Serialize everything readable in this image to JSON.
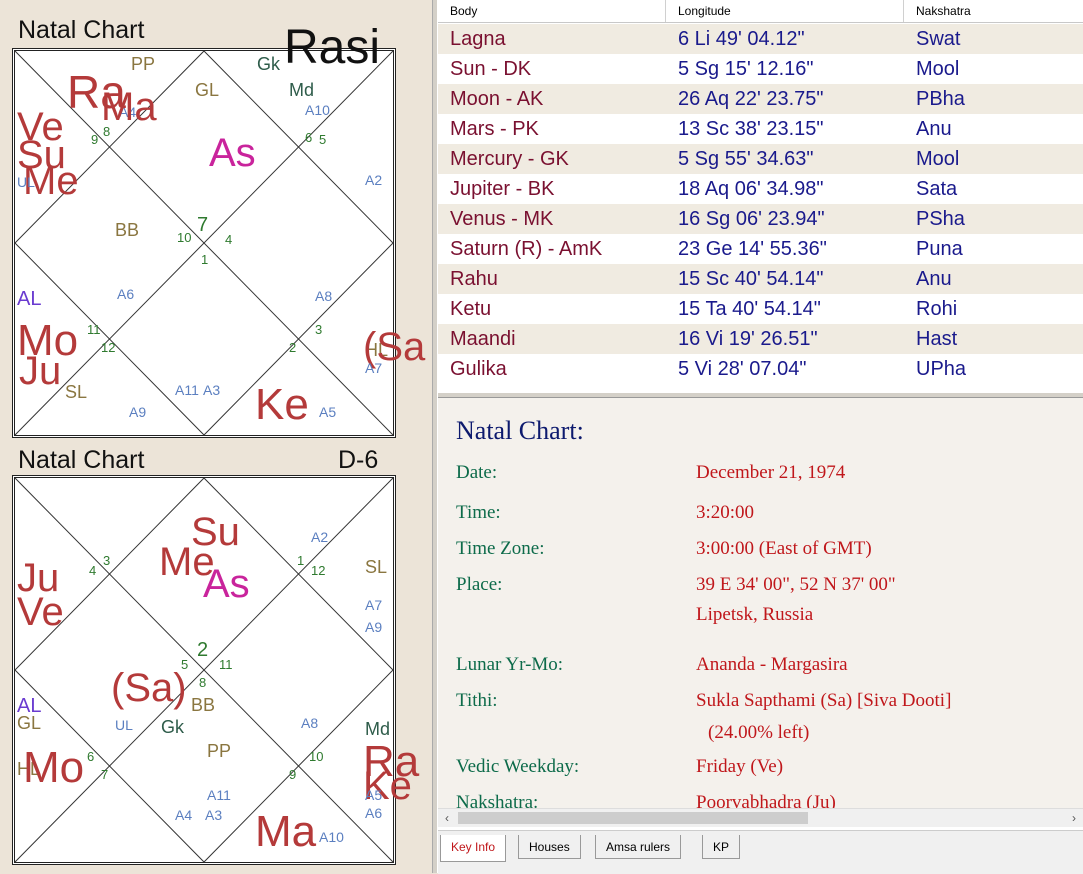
{
  "rasi": {
    "title": "Natal Chart",
    "division": "Rasi",
    "labels": [
      {
        "t": "PP",
        "c": "#8a7640",
        "fs": 18
      },
      {
        "t": "Gk",
        "c": "#2e5c4a",
        "fs": 18
      },
      {
        "t": "GL",
        "c": "#8a7640",
        "fs": 18
      },
      {
        "t": "Md",
        "c": "#2e5c4a",
        "fs": 18
      },
      {
        "t": "A10",
        "c": "#5b7fc0",
        "fs": 14
      },
      {
        "t": "A4",
        "c": "#5b7fc0",
        "fs": 14
      },
      {
        "t": "Ra",
        "c": "#b43a3a",
        "fs": 46
      },
      {
        "t": "Ma",
        "c": "#b43a3a",
        "fs": 40
      },
      {
        "t": "9",
        "c": "#2f7a2f",
        "fs": 13
      },
      {
        "t": "8",
        "c": "#2f7a2f",
        "fs": 13
      },
      {
        "t": "6",
        "c": "#2f7a2f",
        "fs": 13
      },
      {
        "t": "5",
        "c": "#2f7a2f",
        "fs": 13
      },
      {
        "t": "Ve",
        "c": "#b43a3a",
        "fs": 40
      },
      {
        "t": "Su",
        "c": "#b43a3a",
        "fs": 40
      },
      {
        "t": "Me",
        "c": "#b43a3a",
        "fs": 40
      },
      {
        "t": "UL",
        "c": "#5b7fc0",
        "fs": 14
      },
      {
        "t": "As",
        "c": "#c9249c",
        "fs": 40
      },
      {
        "t": "A2",
        "c": "#5b7fc0",
        "fs": 14
      },
      {
        "t": "BB",
        "c": "#8a7640",
        "fs": 18
      },
      {
        "t": "7",
        "c": "#2f7a2f",
        "fs": 20
      },
      {
        "t": "10",
        "c": "#2f7a2f",
        "fs": 13
      },
      {
        "t": "4",
        "c": "#2f7a2f",
        "fs": 13
      },
      {
        "t": "1",
        "c": "#2f7a2f",
        "fs": 13
      },
      {
        "t": "A6",
        "c": "#5b7fc0",
        "fs": 14
      },
      {
        "t": "A8",
        "c": "#5b7fc0",
        "fs": 14
      },
      {
        "t": "AL",
        "c": "#6a3bd0",
        "fs": 20
      },
      {
        "t": "Mo",
        "c": "#b43a3a",
        "fs": 44
      },
      {
        "t": "Ju",
        "c": "#b43a3a",
        "fs": 40
      },
      {
        "t": "11",
        "c": "#2f7a2f",
        "fs": 13
      },
      {
        "t": "12",
        "c": "#2f7a2f",
        "fs": 13
      },
      {
        "t": "3",
        "c": "#2f7a2f",
        "fs": 13
      },
      {
        "t": "2",
        "c": "#2f7a2f",
        "fs": 13
      },
      {
        "t": "HL",
        "c": "#8a7640",
        "fs": 18
      },
      {
        "t": "(Sa",
        "c": "#b43a3a",
        "fs": 40
      },
      {
        "t": "A7",
        "c": "#5b7fc0",
        "fs": 14
      },
      {
        "t": "SL",
        "c": "#8a7640",
        "fs": 18
      },
      {
        "t": "A11",
        "c": "#5b7fc0",
        "fs": 14
      },
      {
        "t": "A3",
        "c": "#5b7fc0",
        "fs": 14
      },
      {
        "t": "A9",
        "c": "#5b7fc0",
        "fs": 14
      },
      {
        "t": "Ke",
        "c": "#b43a3a",
        "fs": 44
      },
      {
        "t": "A5",
        "c": "#5b7fc0",
        "fs": 14
      }
    ]
  },
  "d6": {
    "title": "Natal Chart",
    "division": "D-6",
    "labels": [
      {
        "t": "4",
        "c": "#2f7a2f",
        "fs": 13
      },
      {
        "t": "3",
        "c": "#2f7a2f",
        "fs": 13
      },
      {
        "t": "Su",
        "c": "#b43a3a",
        "fs": 40
      },
      {
        "t": "Me",
        "c": "#b43a3a",
        "fs": 40
      },
      {
        "t": "As",
        "c": "#c9249c",
        "fs": 40
      },
      {
        "t": "A2",
        "c": "#5b7fc0",
        "fs": 14
      },
      {
        "t": "1",
        "c": "#2f7a2f",
        "fs": 13
      },
      {
        "t": "12",
        "c": "#2f7a2f",
        "fs": 13
      },
      {
        "t": "SL",
        "c": "#8a7640",
        "fs": 18
      },
      {
        "t": "Ju",
        "c": "#b43a3a",
        "fs": 40
      },
      {
        "t": "Ve",
        "c": "#b43a3a",
        "fs": 40
      },
      {
        "t": "A7",
        "c": "#5b7fc0",
        "fs": 14
      },
      {
        "t": "A9",
        "c": "#5b7fc0",
        "fs": 14
      },
      {
        "t": "2",
        "c": "#2f7a2f",
        "fs": 20
      },
      {
        "t": "5",
        "c": "#2f7a2f",
        "fs": 13
      },
      {
        "t": "11",
        "c": "#2f7a2f",
        "fs": 13
      },
      {
        "t": "8",
        "c": "#2f7a2f",
        "fs": 13
      },
      {
        "t": "(Sa)",
        "c": "#b43a3a",
        "fs": 40
      },
      {
        "t": "BB",
        "c": "#8a7640",
        "fs": 18
      },
      {
        "t": "AL",
        "c": "#6a3bd0",
        "fs": 20
      },
      {
        "t": "GL",
        "c": "#8a7640",
        "fs": 18
      },
      {
        "t": "UL",
        "c": "#5b7fc0",
        "fs": 14
      },
      {
        "t": "Gk",
        "c": "#2e5c4a",
        "fs": 18
      },
      {
        "t": "A8",
        "c": "#5b7fc0",
        "fs": 14
      },
      {
        "t": "Md",
        "c": "#2e5c4a",
        "fs": 18
      },
      {
        "t": "PP",
        "c": "#8a7640",
        "fs": 18
      },
      {
        "t": "HL",
        "c": "#8a7640",
        "fs": 18
      },
      {
        "t": "Mo",
        "c": "#b43a3a",
        "fs": 44
      },
      {
        "t": "6",
        "c": "#2f7a2f",
        "fs": 13
      },
      {
        "t": "7",
        "c": "#2f7a2f",
        "fs": 13
      },
      {
        "t": "9",
        "c": "#2f7a2f",
        "fs": 13
      },
      {
        "t": "10",
        "c": "#2f7a2f",
        "fs": 13
      },
      {
        "t": "Ra",
        "c": "#b43a3a",
        "fs": 44
      },
      {
        "t": "Ke",
        "c": "#b43a3a",
        "fs": 40
      },
      {
        "t": "A5",
        "c": "#5b7fc0",
        "fs": 14
      },
      {
        "t": "A6",
        "c": "#5b7fc0",
        "fs": 14
      },
      {
        "t": "A11",
        "c": "#5b7fc0",
        "fs": 14
      },
      {
        "t": "A4",
        "c": "#5b7fc0",
        "fs": 14
      },
      {
        "t": "A3",
        "c": "#5b7fc0",
        "fs": 14
      },
      {
        "t": "Ma",
        "c": "#b43a3a",
        "fs": 44
      },
      {
        "t": "A10",
        "c": "#5b7fc0",
        "fs": 14
      }
    ]
  },
  "table": {
    "headers": [
      "Body",
      "Longitude",
      "Nakshatra"
    ],
    "rows": [
      [
        "Lagna",
        "6 Li 49' 04.12\"",
        "Swat"
      ],
      [
        "Sun - DK",
        "5 Sg 15' 12.16\"",
        "Mool"
      ],
      [
        "Moon - AK",
        "26 Aq 22' 23.75\"",
        "PBha"
      ],
      [
        "Mars - PK",
        "13 Sc 38' 23.15\"",
        "Anu"
      ],
      [
        "Mercury - GK",
        "5 Sg 55' 34.63\"",
        "Mool"
      ],
      [
        "Jupiter - BK",
        "18 Aq 06' 34.98\"",
        "Sata"
      ],
      [
        "Venus - MK",
        "16 Sg 06' 23.94\"",
        "PSha"
      ],
      [
        "Saturn (R) - AmK",
        "23 Ge 14' 55.36\"",
        "Puna"
      ],
      [
        "Rahu",
        "15 Sc 40' 54.14\"",
        "Anu"
      ],
      [
        "Ketu",
        "15 Ta 40' 54.14\"",
        "Rohi"
      ],
      [
        "Maandi",
        "16 Vi 19' 26.51\"",
        "Hast"
      ],
      [
        "Gulika",
        "5 Vi 28' 07.04\"",
        "UPha"
      ]
    ]
  },
  "info": {
    "title": "Natal Chart:",
    "rows": [
      {
        "k": "Date:",
        "v": "December 21, 1974"
      },
      {
        "k": "Time:",
        "v": "3:20:00"
      },
      {
        "k": "Time Zone:",
        "v": "3:00:00 (East of GMT)"
      },
      {
        "k": "Place:",
        "v": "39 E 34' 00\", 52 N 37' 00\""
      },
      {
        "k": "",
        "v": "Lipetsk, Russia"
      },
      {
        "k": "Lunar Yr-Mo:",
        "v": "Ananda - Margasira"
      },
      {
        "k": "Tithi:",
        "v": "Sukla Sapthami (Sa) [Siva Dooti]"
      },
      {
        "k": "",
        "v": "(24.00% left)"
      },
      {
        "k": "Vedic Weekday:",
        "v": "Friday (Ve)"
      },
      {
        "k": "Nakshatra:",
        "v": "Poorvabhadra (Ju)"
      }
    ]
  },
  "scroll": {
    "left": "‹",
    "right": "›"
  },
  "tabs": [
    "Key Info",
    "Houses",
    "Amsa rulers",
    "KP"
  ],
  "active_tab": "Key Info"
}
